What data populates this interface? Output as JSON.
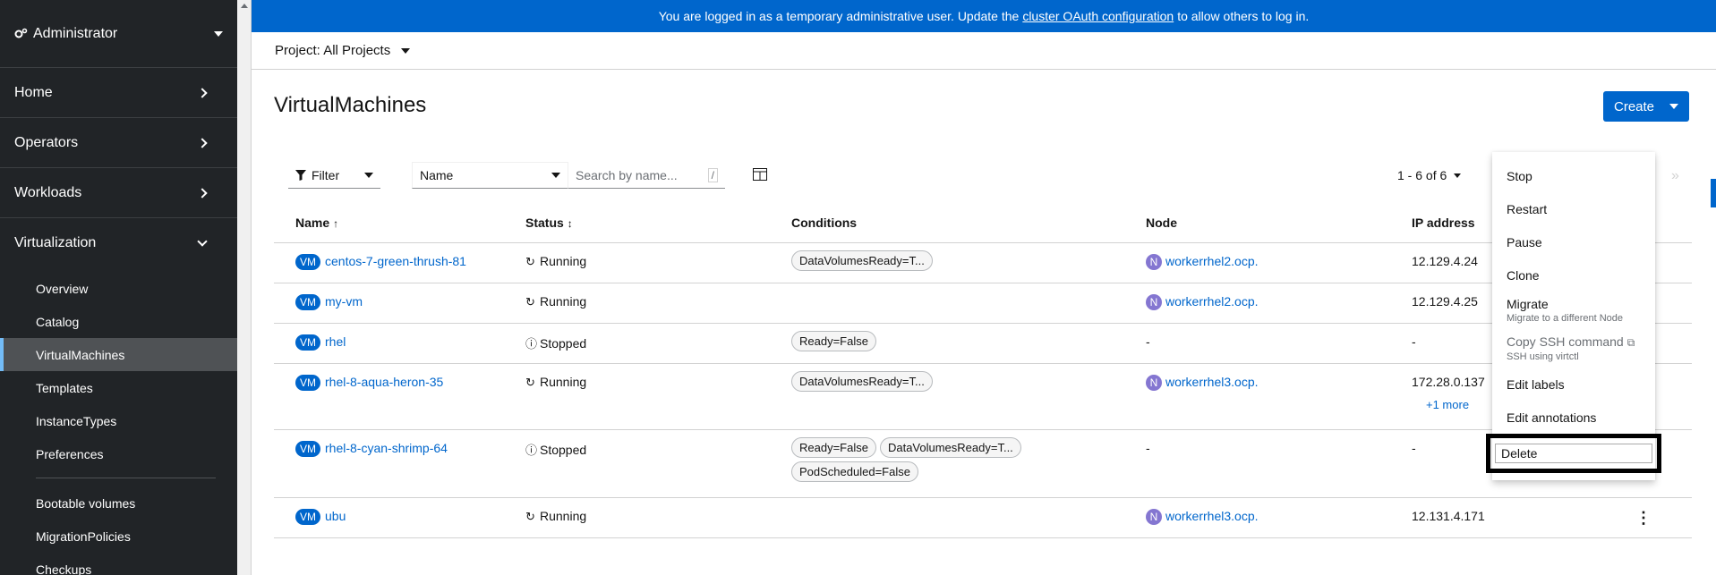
{
  "sidebar": {
    "perspective": "Administrator",
    "sections": [
      {
        "label": "Home"
      },
      {
        "label": "Operators"
      },
      {
        "label": "Workloads"
      },
      {
        "label": "Virtualization"
      }
    ],
    "virtualization_items": [
      {
        "label": "Overview"
      },
      {
        "label": "Catalog"
      },
      {
        "label": "VirtualMachines"
      },
      {
        "label": "Templates"
      },
      {
        "label": "InstanceTypes"
      },
      {
        "label": "Preferences"
      },
      {
        "label": "Bootable volumes"
      },
      {
        "label": "MigrationPolicies"
      },
      {
        "label": "Checkups"
      }
    ]
  },
  "banner": {
    "prefix": "You are logged in as a temporary administrative user. Update the",
    "link": "cluster OAuth configuration",
    "suffix": "to allow others to log in."
  },
  "project": {
    "label": "Project: All Projects"
  },
  "page": {
    "title": "VirtualMachines",
    "create_label": "Create"
  },
  "toolbar": {
    "filter_label": "Filter",
    "name_select": "Name",
    "search_placeholder": "Search by name...",
    "search_shortcut": "/",
    "pagination": "1 - 6 of 6",
    "last_page": "»"
  },
  "table": {
    "headers": {
      "name": "Name",
      "status": "Status",
      "conditions": "Conditions",
      "node": "Node",
      "ip": "IP address"
    },
    "vm_badge": "VM",
    "node_badge": "N",
    "rows": [
      {
        "name": "centos-7-green-thrush-81",
        "status": "Running",
        "conditions": [
          "DataVolumesReady=T..."
        ],
        "node": "workerrhel2.ocp.",
        "ip": "12.129.4.24"
      },
      {
        "name": "my-vm",
        "status": "Running",
        "conditions": [],
        "node": "workerrhel2.ocp.",
        "ip": "12.129.4.25"
      },
      {
        "name": "rhel",
        "status": "Stopped",
        "conditions": [
          "Ready=False"
        ],
        "node": "-",
        "ip": "-"
      },
      {
        "name": "rhel-8-aqua-heron-35",
        "status": "Running",
        "conditions": [
          "DataVolumesReady=T..."
        ],
        "node": "workerrhel3.ocp.",
        "ip": "172.28.0.137",
        "ip_more": "+1 more"
      },
      {
        "name": "rhel-8-cyan-shrimp-64",
        "status": "Stopped",
        "conditions": [
          "Ready=False",
          "DataVolumesReady=T...",
          "PodScheduled=False"
        ],
        "node": "-",
        "ip": "-"
      },
      {
        "name": "ubu",
        "status": "Running",
        "conditions": [],
        "node": "workerrhel3.ocp.",
        "ip": "12.131.4.171"
      }
    ]
  },
  "menu": {
    "stop": "Stop",
    "restart": "Restart",
    "pause": "Pause",
    "clone": "Clone",
    "migrate": "Migrate",
    "migrate_desc": "Migrate to a different Node",
    "copy_ssh": "Copy SSH command",
    "copy_ssh_desc": "SSH using virtctl",
    "edit_labels": "Edit labels",
    "edit_annotations": "Edit annotations",
    "delete": "Delete"
  },
  "colors": {
    "primary": "#0066cc",
    "sidebar": "#212427",
    "node_badge": "#8476d1"
  }
}
